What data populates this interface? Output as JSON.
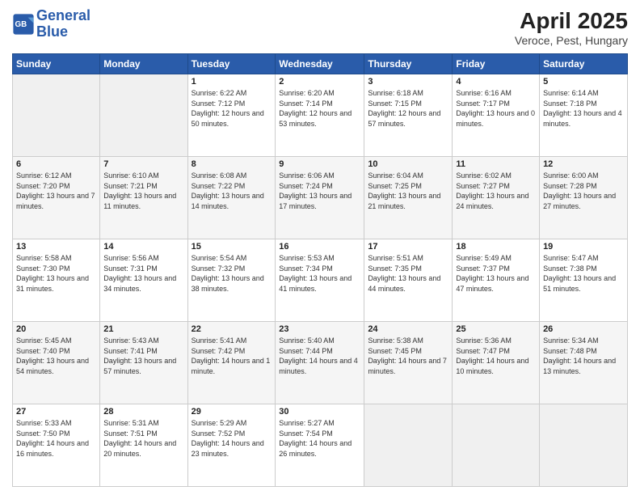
{
  "header": {
    "logo_line1": "General",
    "logo_line2": "Blue",
    "title": "April 2025",
    "subtitle": "Veroce, Pest, Hungary"
  },
  "weekdays": [
    "Sunday",
    "Monday",
    "Tuesday",
    "Wednesday",
    "Thursday",
    "Friday",
    "Saturday"
  ],
  "weeks": [
    [
      {
        "day": "",
        "info": ""
      },
      {
        "day": "",
        "info": ""
      },
      {
        "day": "1",
        "info": "Sunrise: 6:22 AM\nSunset: 7:12 PM\nDaylight: 12 hours and 50 minutes."
      },
      {
        "day": "2",
        "info": "Sunrise: 6:20 AM\nSunset: 7:14 PM\nDaylight: 12 hours and 53 minutes."
      },
      {
        "day": "3",
        "info": "Sunrise: 6:18 AM\nSunset: 7:15 PM\nDaylight: 12 hours and 57 minutes."
      },
      {
        "day": "4",
        "info": "Sunrise: 6:16 AM\nSunset: 7:17 PM\nDaylight: 13 hours and 0 minutes."
      },
      {
        "day": "5",
        "info": "Sunrise: 6:14 AM\nSunset: 7:18 PM\nDaylight: 13 hours and 4 minutes."
      }
    ],
    [
      {
        "day": "6",
        "info": "Sunrise: 6:12 AM\nSunset: 7:20 PM\nDaylight: 13 hours and 7 minutes."
      },
      {
        "day": "7",
        "info": "Sunrise: 6:10 AM\nSunset: 7:21 PM\nDaylight: 13 hours and 11 minutes."
      },
      {
        "day": "8",
        "info": "Sunrise: 6:08 AM\nSunset: 7:22 PM\nDaylight: 13 hours and 14 minutes."
      },
      {
        "day": "9",
        "info": "Sunrise: 6:06 AM\nSunset: 7:24 PM\nDaylight: 13 hours and 17 minutes."
      },
      {
        "day": "10",
        "info": "Sunrise: 6:04 AM\nSunset: 7:25 PM\nDaylight: 13 hours and 21 minutes."
      },
      {
        "day": "11",
        "info": "Sunrise: 6:02 AM\nSunset: 7:27 PM\nDaylight: 13 hours and 24 minutes."
      },
      {
        "day": "12",
        "info": "Sunrise: 6:00 AM\nSunset: 7:28 PM\nDaylight: 13 hours and 27 minutes."
      }
    ],
    [
      {
        "day": "13",
        "info": "Sunrise: 5:58 AM\nSunset: 7:30 PM\nDaylight: 13 hours and 31 minutes."
      },
      {
        "day": "14",
        "info": "Sunrise: 5:56 AM\nSunset: 7:31 PM\nDaylight: 13 hours and 34 minutes."
      },
      {
        "day": "15",
        "info": "Sunrise: 5:54 AM\nSunset: 7:32 PM\nDaylight: 13 hours and 38 minutes."
      },
      {
        "day": "16",
        "info": "Sunrise: 5:53 AM\nSunset: 7:34 PM\nDaylight: 13 hours and 41 minutes."
      },
      {
        "day": "17",
        "info": "Sunrise: 5:51 AM\nSunset: 7:35 PM\nDaylight: 13 hours and 44 minutes."
      },
      {
        "day": "18",
        "info": "Sunrise: 5:49 AM\nSunset: 7:37 PM\nDaylight: 13 hours and 47 minutes."
      },
      {
        "day": "19",
        "info": "Sunrise: 5:47 AM\nSunset: 7:38 PM\nDaylight: 13 hours and 51 minutes."
      }
    ],
    [
      {
        "day": "20",
        "info": "Sunrise: 5:45 AM\nSunset: 7:40 PM\nDaylight: 13 hours and 54 minutes."
      },
      {
        "day": "21",
        "info": "Sunrise: 5:43 AM\nSunset: 7:41 PM\nDaylight: 13 hours and 57 minutes."
      },
      {
        "day": "22",
        "info": "Sunrise: 5:41 AM\nSunset: 7:42 PM\nDaylight: 14 hours and 1 minute."
      },
      {
        "day": "23",
        "info": "Sunrise: 5:40 AM\nSunset: 7:44 PM\nDaylight: 14 hours and 4 minutes."
      },
      {
        "day": "24",
        "info": "Sunrise: 5:38 AM\nSunset: 7:45 PM\nDaylight: 14 hours and 7 minutes."
      },
      {
        "day": "25",
        "info": "Sunrise: 5:36 AM\nSunset: 7:47 PM\nDaylight: 14 hours and 10 minutes."
      },
      {
        "day": "26",
        "info": "Sunrise: 5:34 AM\nSunset: 7:48 PM\nDaylight: 14 hours and 13 minutes."
      }
    ],
    [
      {
        "day": "27",
        "info": "Sunrise: 5:33 AM\nSunset: 7:50 PM\nDaylight: 14 hours and 16 minutes."
      },
      {
        "day": "28",
        "info": "Sunrise: 5:31 AM\nSunset: 7:51 PM\nDaylight: 14 hours and 20 minutes."
      },
      {
        "day": "29",
        "info": "Sunrise: 5:29 AM\nSunset: 7:52 PM\nDaylight: 14 hours and 23 minutes."
      },
      {
        "day": "30",
        "info": "Sunrise: 5:27 AM\nSunset: 7:54 PM\nDaylight: 14 hours and 26 minutes."
      },
      {
        "day": "",
        "info": ""
      },
      {
        "day": "",
        "info": ""
      },
      {
        "day": "",
        "info": ""
      }
    ]
  ]
}
